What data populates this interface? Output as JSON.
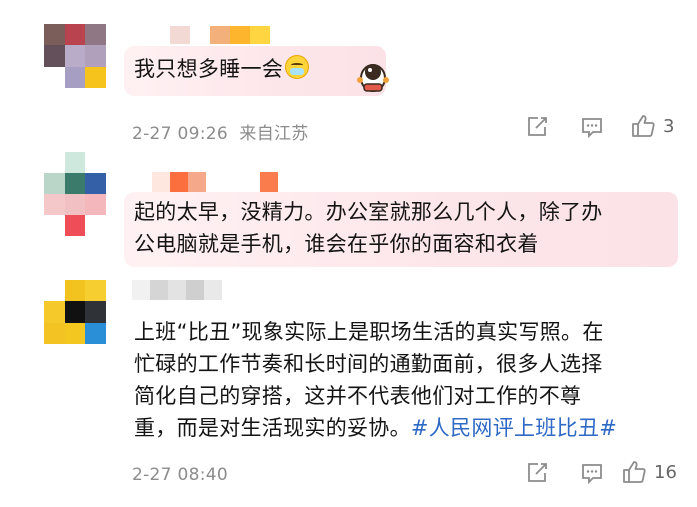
{
  "comments": [
    {
      "lines": [
        "我只想多睡一会"
      ],
      "emoji": "face-with-medical-mask",
      "sticker": "astronaut-sticker",
      "time": "2-27 09:26",
      "location": "来自江苏",
      "likes": "3"
    },
    {
      "lines": [
        "起的太早，没精力。办公室就那么几个人，除了办",
        "公电脑就是手机，谁会在乎你的面容和衣着"
      ],
      "time": "",
      "likes": ""
    },
    {
      "lines": [
        "上班“比丑”现象实际上是职场生活的真实写照。在",
        "忙碌的工作节奏和长时间的通勤面前，很多人选择",
        "简化自己的穿搭，这并不代表他们对工作的不尊"
      ],
      "last_line_text": "重，而是对生活现实的妥协。",
      "hashtag": "#人民网评上班比丑#",
      "time": "2-27 08:40",
      "likes": "16"
    }
  ],
  "icons": {
    "repost": "repost-icon",
    "comment": "comment-icon",
    "like": "thumbs-up-icon"
  },
  "colors": {
    "hashtag": "#2f69c6",
    "meta": "#8c8c8c",
    "bubble": "#fde6ea"
  }
}
